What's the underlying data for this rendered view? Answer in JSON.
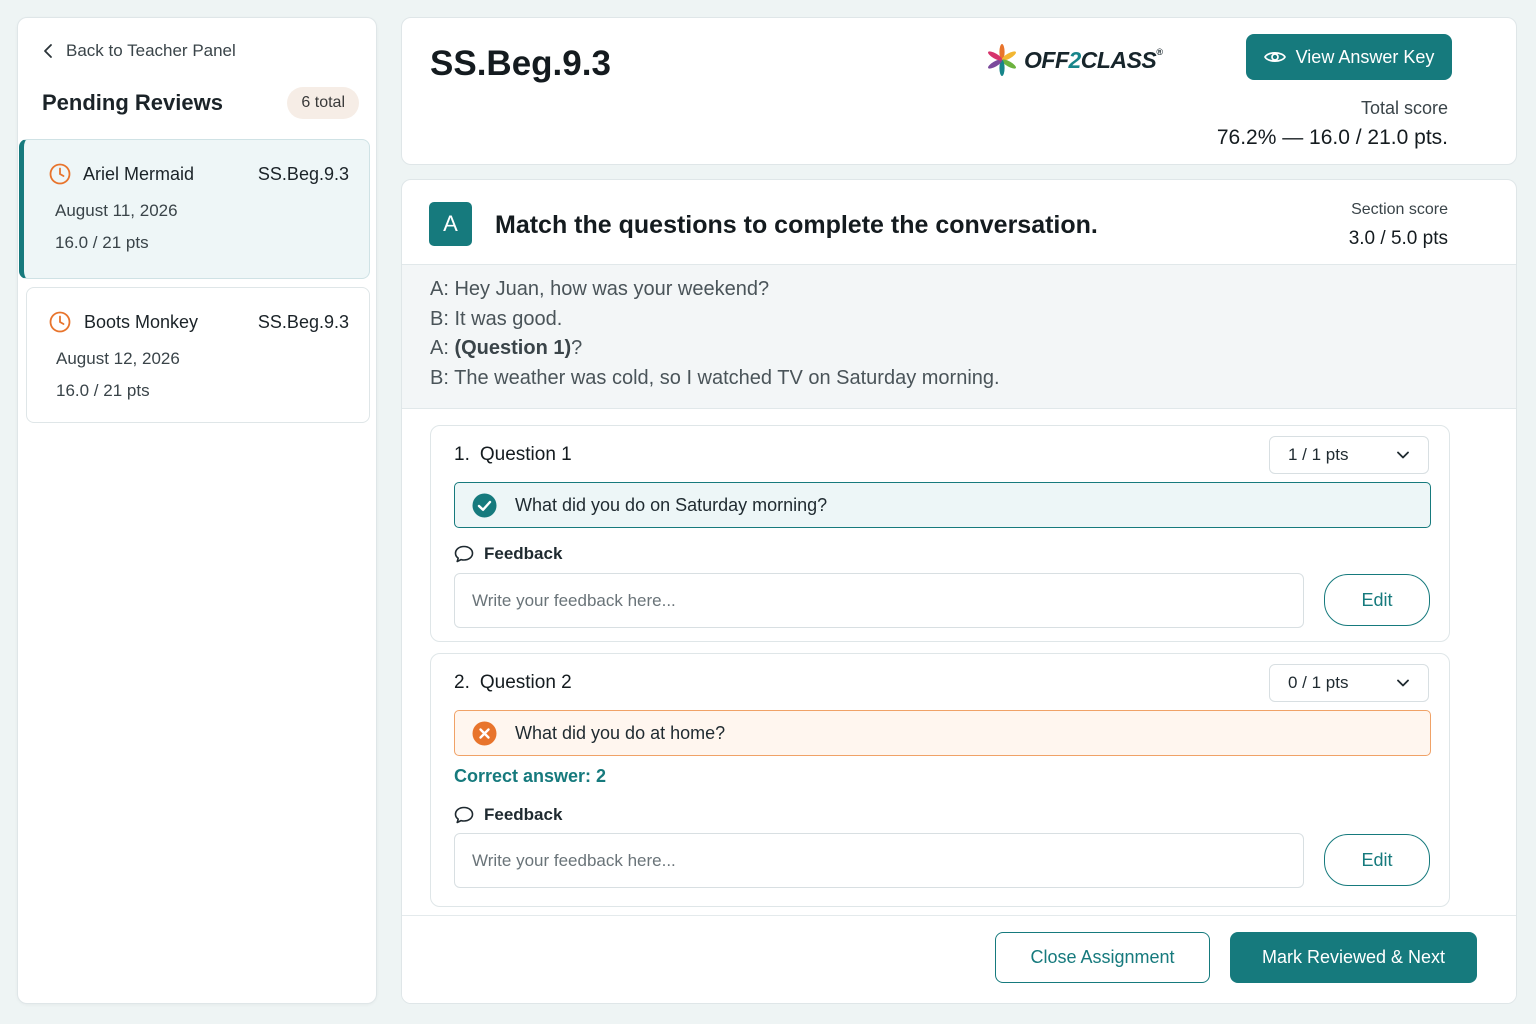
{
  "sidebar": {
    "back_label": "Back to Teacher Panel",
    "title": "Pending Reviews",
    "total_badge": "6 total",
    "reviews": [
      {
        "name": "Ariel Mermaid",
        "code": "SS.Beg.9.3",
        "date": "August 11, 2026",
        "pts": "16.0 / 21 pts",
        "active": true
      },
      {
        "name": "Boots Monkey",
        "code": "SS.Beg.9.3",
        "date": "August 12, 2026",
        "pts": "16.0 / 21 pts",
        "active": false
      }
    ]
  },
  "header": {
    "title": "SS.Beg.9.3",
    "logo": {
      "part1": "OFF",
      "part2": "2",
      "part3": "CLASS",
      "mark": "®"
    },
    "answer_key_label": "View Answer Key",
    "total_label": "Total score",
    "total_value": "76.2% — 16.0 / 21.0 pts."
  },
  "section": {
    "badge": "A",
    "title": "Match the questions to complete the conversation.",
    "score_label": "Section score",
    "score_value": "3.0 / 5.0 pts",
    "dialogue": [
      {
        "speaker": "A:",
        "text": "Hey Juan, how was your weekend?"
      },
      {
        "speaker": "B:",
        "text": "It was good."
      },
      {
        "speaker": "A:",
        "bold": "(Question 1)",
        "text": "?"
      },
      {
        "speaker": "B:",
        "text": "The weather was cold, so I watched TV on Saturday morning."
      }
    ],
    "questions": [
      {
        "number": "1.",
        "title": "Question 1",
        "points": "1 / 1 pts",
        "answer": "What did you do on Saturday morning?",
        "status": "correct",
        "feedback_label": "Feedback",
        "feedback_placeholder": "Write your feedback here...",
        "edit_label": "Edit"
      },
      {
        "number": "2.",
        "title": "Question 2",
        "points": "0 / 1 pts",
        "answer": "What did you do at home?",
        "status": "wrong",
        "correct_answer": "Correct answer: 2",
        "feedback_label": "Feedback",
        "feedback_placeholder": "Write your feedback here...",
        "edit_label": "Edit"
      }
    ]
  },
  "footer": {
    "close_label": "Close Assignment",
    "next_label": "Mark Reviewed & Next"
  },
  "colors": {
    "accent": "#167a7d",
    "warning": "#e8742c",
    "background": "#eef4f4"
  }
}
